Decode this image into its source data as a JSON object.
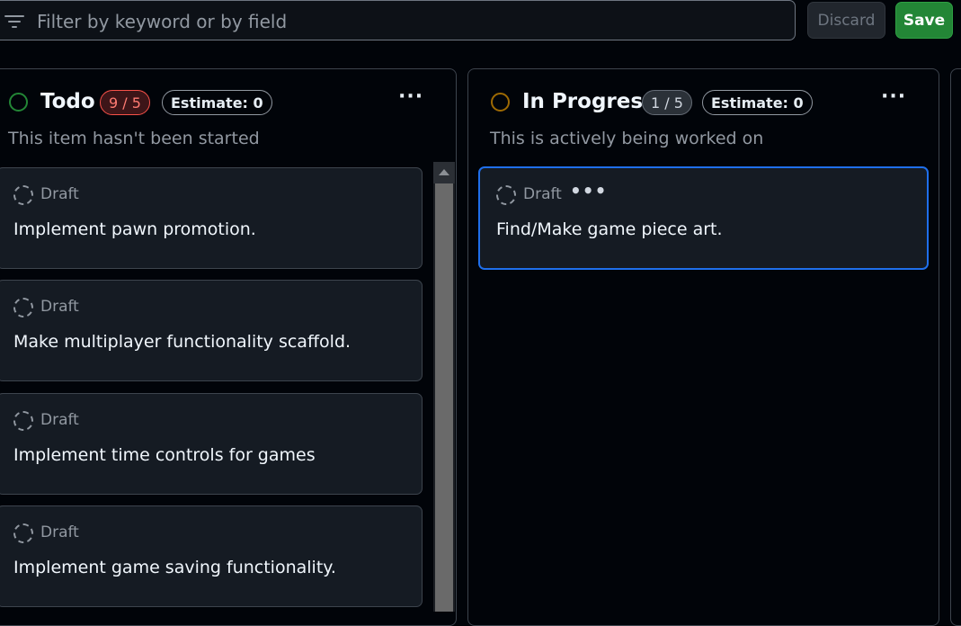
{
  "filter": {
    "placeholder": "Filter by keyword or by field",
    "icon": "filter-icon"
  },
  "actions": {
    "discard_label": "Discard",
    "save_label": "Save"
  },
  "columns": [
    {
      "title": "Todo",
      "count": "9 / 5",
      "estimate": "Estimate: 0",
      "description": "This item hasn't been started",
      "status_color": "#238636",
      "menu": "···",
      "cards": [
        {
          "type": "Draft",
          "title": "Implement pawn promotion."
        },
        {
          "type": "Draft",
          "title": "Make multiplayer functionality scaffold."
        },
        {
          "type": "Draft",
          "title": "Implement time controls for games"
        },
        {
          "type": "Draft",
          "title": "Implement game saving functionality."
        }
      ]
    },
    {
      "title": "In Progress",
      "count": "1 / 5",
      "estimate": "Estimate: 0",
      "description": "This is actively being worked on",
      "status_color": "#9e6a03",
      "menu": "···",
      "cards": [
        {
          "type": "Draft",
          "title": "Find/Make game piece art.",
          "selected": true,
          "menu": "•••"
        }
      ]
    }
  ],
  "colors": {
    "background": "#010409",
    "card": "#151b23",
    "accent_blue": "#1f6feb",
    "save_green": "#238636",
    "over_limit": "#f85149"
  }
}
